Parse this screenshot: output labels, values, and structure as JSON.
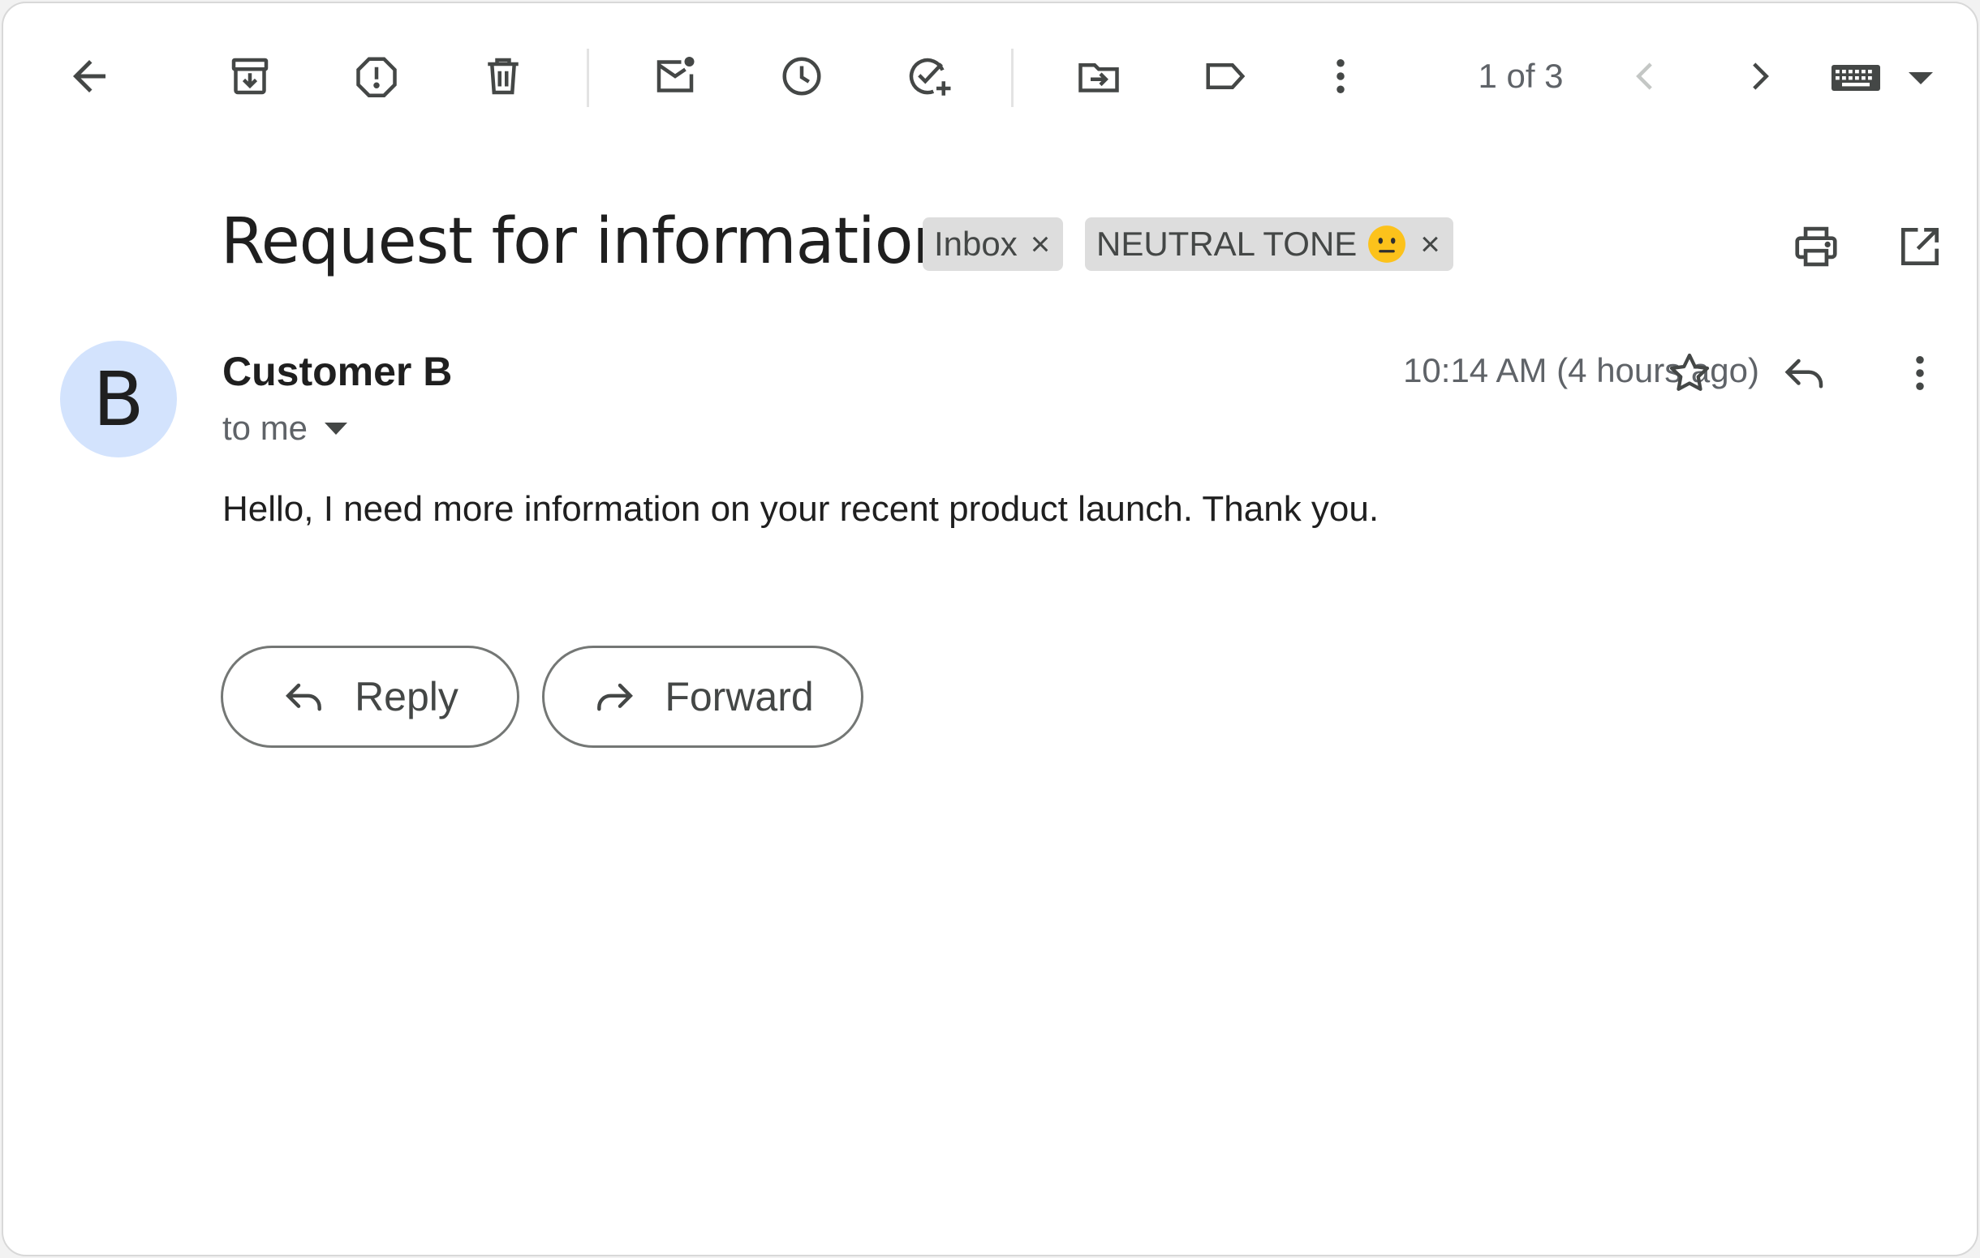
{
  "pager": {
    "text": "1 of 3"
  },
  "email": {
    "subject": "Request for information",
    "labels": [
      {
        "name": "Inbox",
        "remove": "×"
      },
      {
        "name": "NEUTRAL TONE",
        "remove": "×"
      }
    ],
    "sender": {
      "initial": "B",
      "name": "Customer B"
    },
    "recipient": "to me",
    "time": "10:14 AM (4 hours ago)",
    "body": "Hello, I need more information on your recent product launch. Thank you."
  },
  "actions": {
    "reply": "Reply",
    "forward": "Forward"
  },
  "icons": {
    "toolbar": [
      "back-arrow-icon",
      "archive-icon",
      "report-spam-icon",
      "delete-icon",
      "mark-unread-icon",
      "snooze-icon",
      "add-to-tasks-icon",
      "move-to-icon",
      "label-icon",
      "more-vert-icon",
      "chevron-left-icon",
      "chevron-right-icon",
      "keyboard-icon"
    ],
    "header": [
      "print-icon",
      "open-in-new-window-icon"
    ],
    "message": [
      "star-icon",
      "reply-icon",
      "more-vert-icon"
    ]
  },
  "colors": {
    "avatar_bg": "#d3e3fd",
    "chip_bg": "#dddddd",
    "icon": "#444746",
    "muted_text": "#5f6368"
  }
}
